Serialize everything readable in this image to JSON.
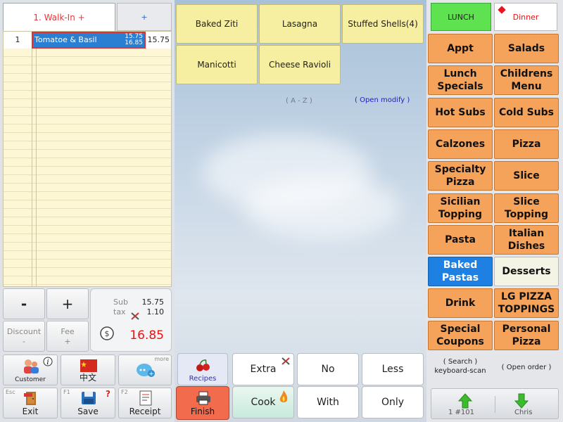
{
  "order_tabs": {
    "current": "1. Walk-In +",
    "add": "+"
  },
  "order_lines": [
    {
      "qty": "1",
      "name": "Tomatoe & Basil",
      "price_top": "15.75",
      "price_bottom": "16.85",
      "total": "15.75"
    }
  ],
  "qty_controls": {
    "minus": "-",
    "plus": "+",
    "discount": "Discount",
    "discount_sub": "-",
    "fee": "Fee",
    "fee_sub": "+"
  },
  "totals": {
    "sub_label": "Sub",
    "sub_value": "15.75",
    "tax_label": "tax",
    "tax_value": "1.10",
    "grand_total": "16.85"
  },
  "toolbar": {
    "customer": "Customer",
    "chinese": "中文",
    "more": "more",
    "exit_key": "Esc",
    "exit": "Exit",
    "save_key": "F1",
    "save": "Save",
    "receipt_key": "F2",
    "receipt": "Receipt"
  },
  "items": [
    "Baked Ziti",
    "Lasagna",
    "Stuffed Shells(4)",
    "Manicotti",
    "Cheese Ravioli"
  ],
  "sort_label": "( A - Z )",
  "open_modify": "( Open modify )",
  "recipes": "Recipes",
  "finish": "Finish",
  "modifiers": [
    "Extra",
    "No",
    "Less",
    "Cook",
    "With",
    "Only"
  ],
  "menu_tabs": {
    "lunch": "LUNCH",
    "dinner": "Dinner"
  },
  "categories": [
    "Appt",
    "Salads",
    "Lunch Specials",
    "Childrens Menu",
    "Hot Subs",
    "Cold Subs",
    "Calzones",
    "Pizza",
    "Specialty Pizza",
    "Slice",
    "Sicilian Topping",
    "Slice Topping",
    "Pasta",
    "Italian Dishes",
    "Baked Pastas",
    "Desserts",
    "Drink",
    "LG PIZZA TOPPINGS",
    "Special Coupons",
    "Personal Pizza"
  ],
  "active_category": "Baked Pastas",
  "search": {
    "line1": "( Search )",
    "line2": "keyboard-scan"
  },
  "open_order": "( Open order )",
  "order_number": "1  #101",
  "server": "Chris",
  "colors": {
    "category": "#f5a35a",
    "active": "#1e80e3",
    "item": "#f6eea0",
    "finish": "#f26b4d",
    "lunch": "#5fe24f",
    "total": "#e11"
  }
}
